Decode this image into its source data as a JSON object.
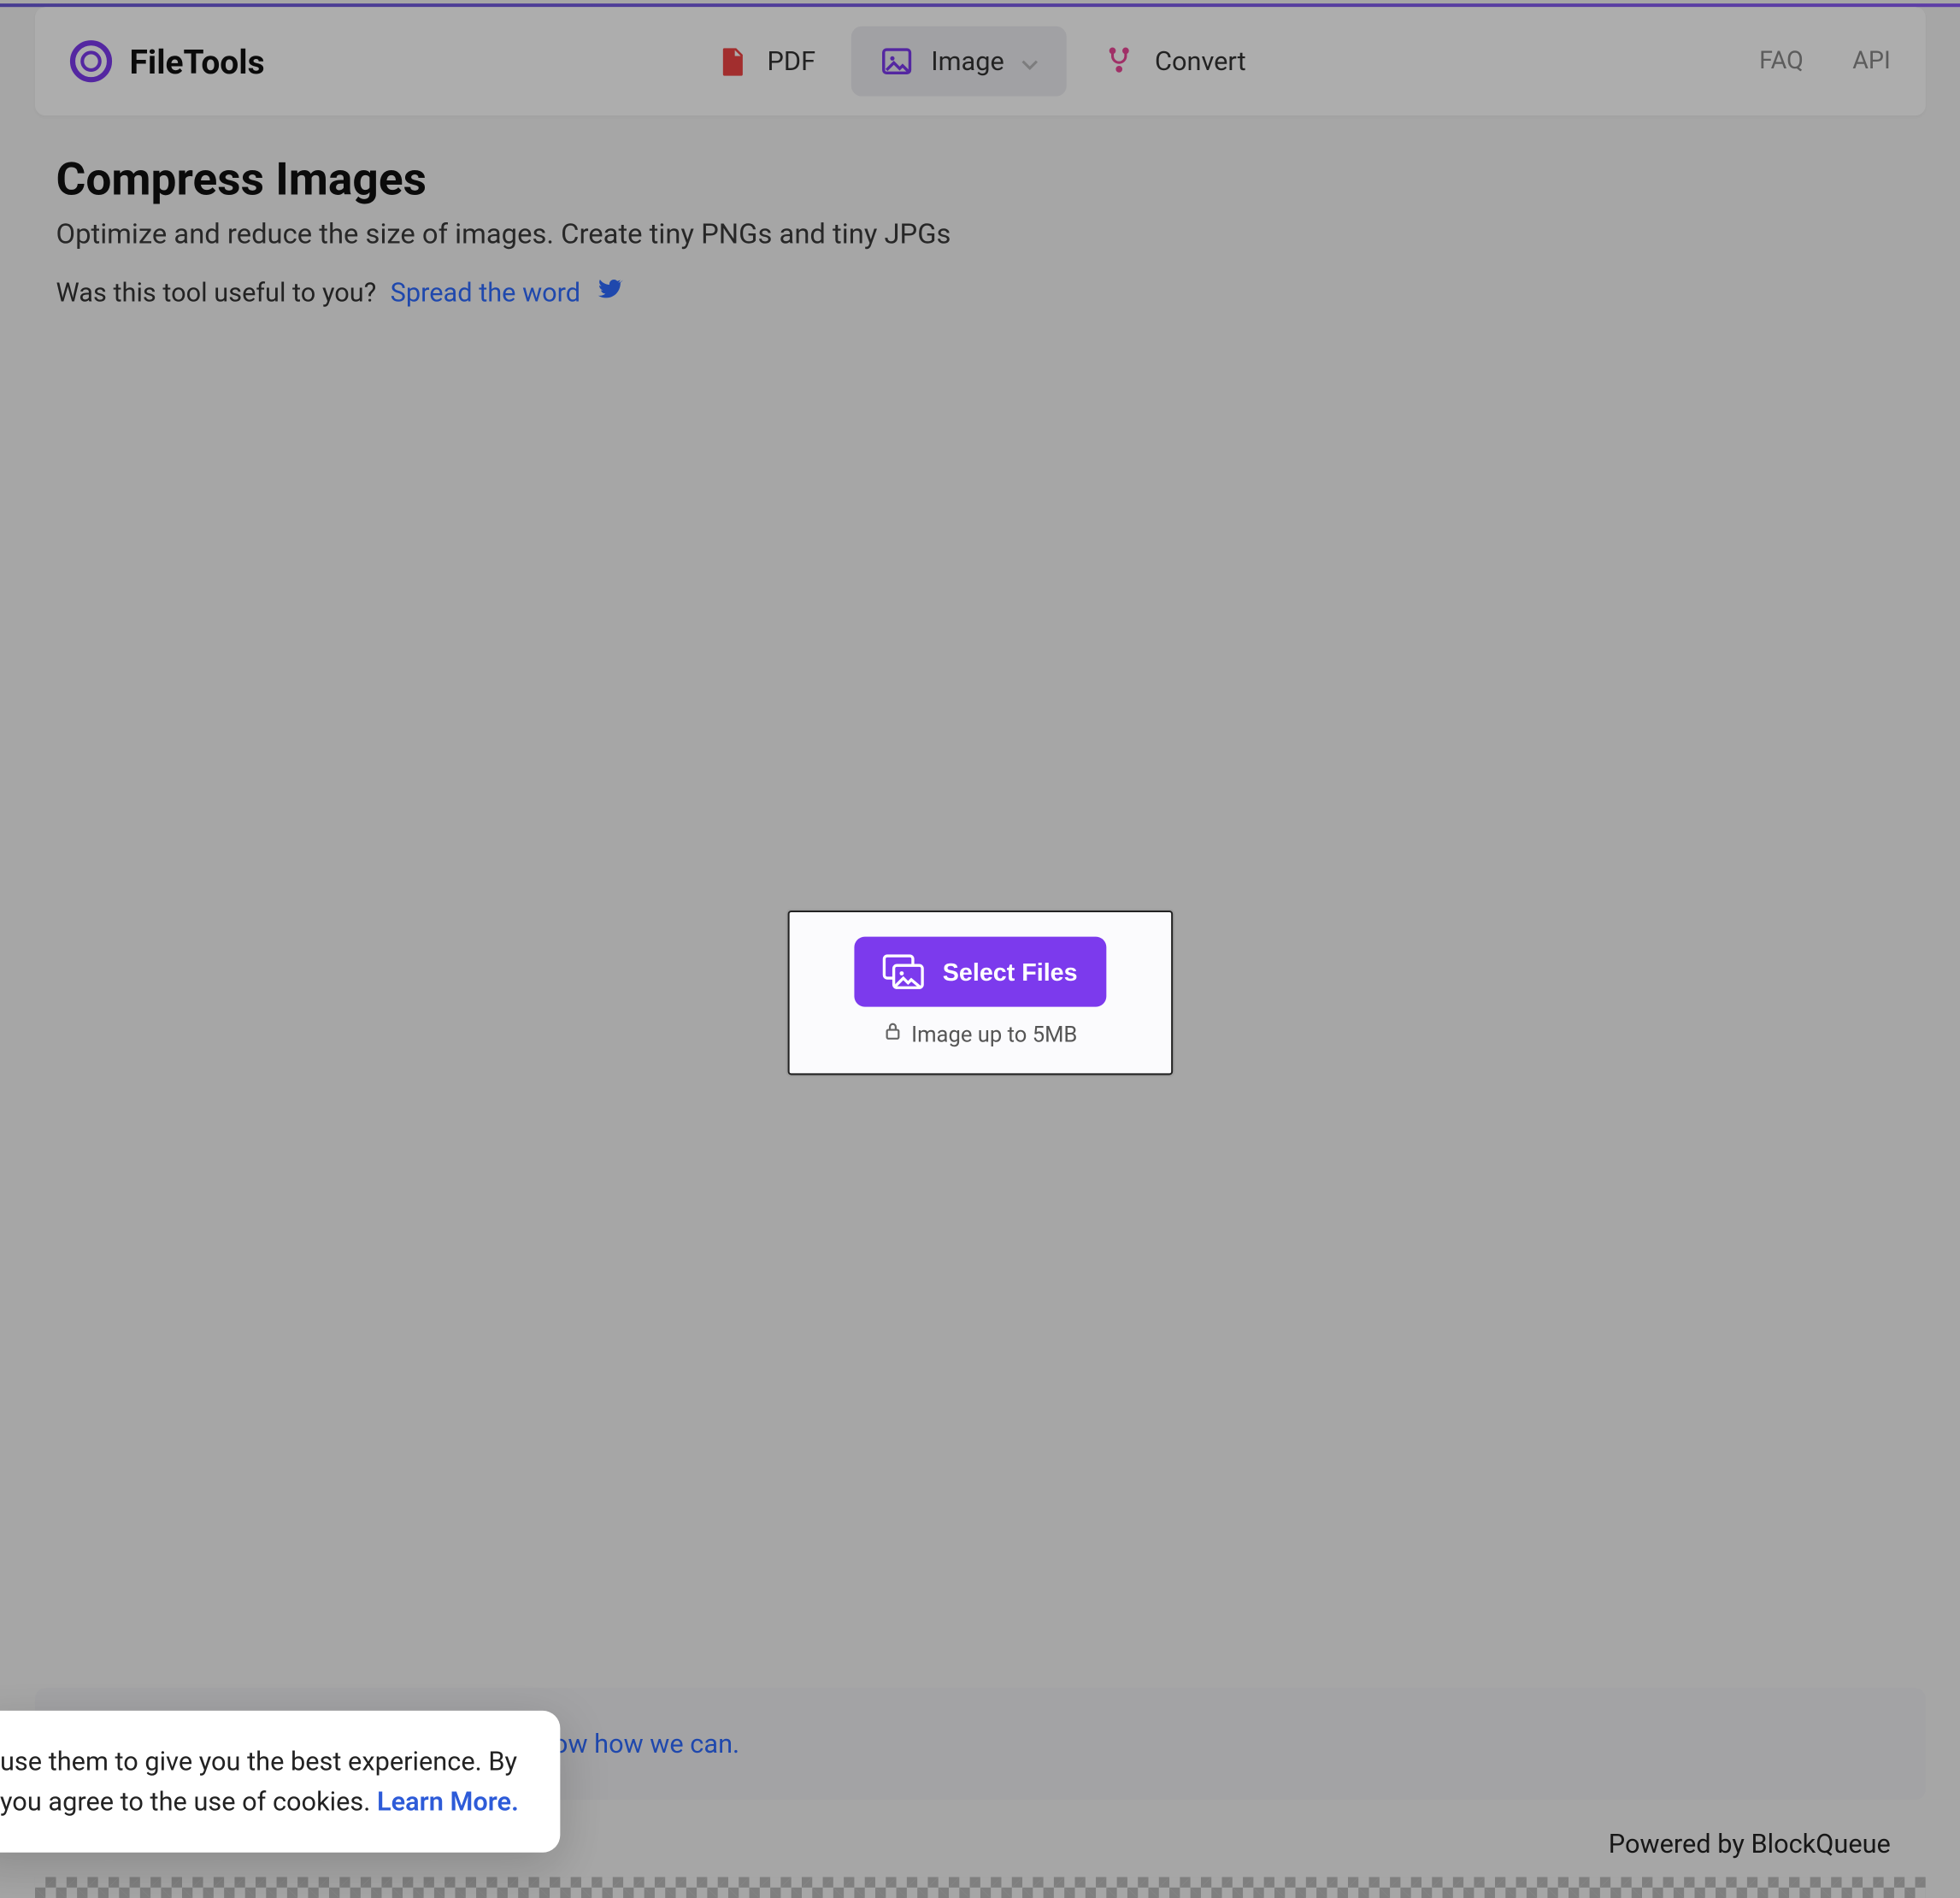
{
  "brand": {
    "name": "FileTools"
  },
  "nav": {
    "items": [
      {
        "label": "PDF"
      },
      {
        "label": "Image"
      },
      {
        "label": "Convert"
      }
    ],
    "right": {
      "faq": "FAQ",
      "api": "API"
    }
  },
  "header": {
    "title": "Compress Images",
    "subtitle": "Optimize and reduce the size of images. Create tiny PNGs and tiny JPGs",
    "share_q": "Was this tool useful to you?",
    "share_link": "Spread the word"
  },
  "dropzone": {
    "button": "Select Files",
    "hint": "Image up to 5MB"
  },
  "cookies": {
    "line1": "use them to give you the best experience. By",
    "line2": "you agree to the use of cookies.",
    "learn": "Learn More."
  },
  "feedback": {
    "tail": "know how we can."
  },
  "footer": {
    "powered": "Powered by BlockQueue"
  }
}
